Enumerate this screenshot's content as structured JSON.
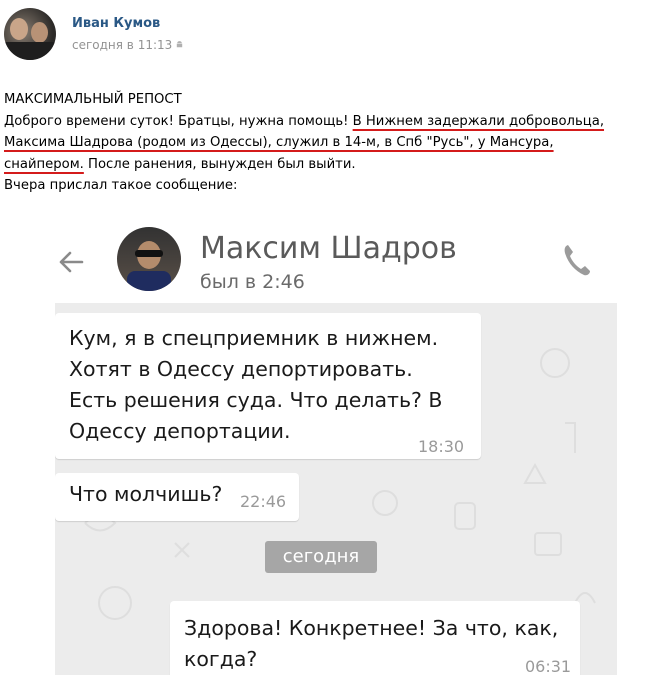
{
  "post": {
    "author": "Иван Кумов",
    "timestamp": "сегодня в 11:13",
    "lines": [
      [
        "МАКСИМАЛЬНЫЙ РЕПОСТ"
      ],
      [
        "Доброго времени суток! Братцы, нужна помощь! ",
        "В Нижнем задержали добровольца,"
      ],
      [
        "Максима Шадрова (родом из Одессы), служил в 14-м, в Спб \"Русь\", у Мансура,"
      ],
      [
        "снайпером.",
        " После ранения, вынужден был выйти."
      ],
      [
        "Вчера прислал такое сообщение:"
      ]
    ]
  },
  "chat": {
    "contact_name": "Максим Шадров",
    "status": "был в 2:46",
    "messages": [
      {
        "lines": [
          "Кум, я в  спецприемник в нижнем.",
          "Хотят в Одессу депортировать.",
          "Есть решения суда. Что делать? В",
          "Одессу депортации."
        ],
        "time": "18:30"
      },
      {
        "lines": [
          "Что молчишь?"
        ],
        "time": "22:46"
      },
      {
        "lines": [
          "Здорова! Конкретнее! За что, как,",
          "когда?"
        ],
        "time": "06:31"
      }
    ],
    "date_separator": "сегодня"
  },
  "colors": {
    "link": "#2a5885",
    "underline": "#d41b1b",
    "chat_bg": "#ececec"
  },
  "icons": [
    "avatar",
    "android-icon",
    "back-arrow-icon",
    "contact-avatar",
    "phone-icon"
  ]
}
